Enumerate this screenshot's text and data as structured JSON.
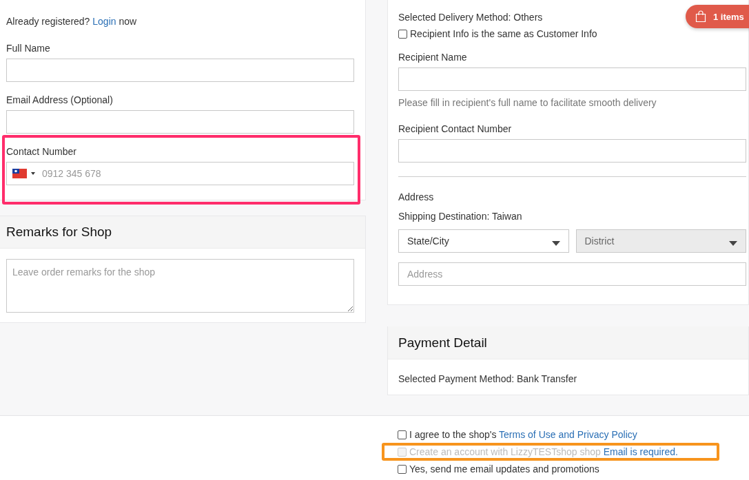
{
  "cart": {
    "label": "1 items"
  },
  "customer": {
    "login_prompt": {
      "before": "Already registered?",
      "link": "Login",
      "after": "now"
    },
    "fields": [
      {
        "kind": "text",
        "label": "Full Name"
      },
      {
        "kind": "text",
        "label": "Email Address (Optional)"
      },
      {
        "kind": "phone",
        "label": "Contact Number",
        "placeholder": "0912 345 678",
        "highlighted": true
      }
    ]
  },
  "remarks": {
    "title": "Remarks for Shop",
    "placeholder": "Leave order remarks for the shop"
  },
  "delivery": {
    "method": "Selected Delivery Method: Others",
    "same_as_customer": {
      "label": "Recipient Info is the same as Customer Info",
      "checked": false
    },
    "recipient_name": {
      "label": "Recipient Name",
      "hint": "Please fill in recipient's full name to facilitate smooth delivery"
    },
    "recipient_contact": {
      "label": "Recipient Contact Number"
    },
    "address": {
      "title": "Address",
      "destination": "Shipping Destination: Taiwan",
      "selects": [
        {
          "value": "State/City",
          "disabled": false
        },
        {
          "value": "District",
          "disabled": true
        }
      ],
      "placeholder": "Address"
    }
  },
  "payment": {
    "title": "Payment Detail",
    "method": "Selected Payment Method: Bank Transfer"
  },
  "agreements": [
    {
      "checked": false,
      "disabled": false,
      "text": "I agree to the shop's",
      "link": "Terms of Use and Privacy Policy"
    },
    {
      "checked": false,
      "disabled": true,
      "text": "Create an account with LizzyTESTshop shop",
      "link": "Email is required.",
      "highlighted": true
    },
    {
      "checked": false,
      "disabled": false,
      "text": "Yes, send me email updates and promotions"
    }
  ]
}
